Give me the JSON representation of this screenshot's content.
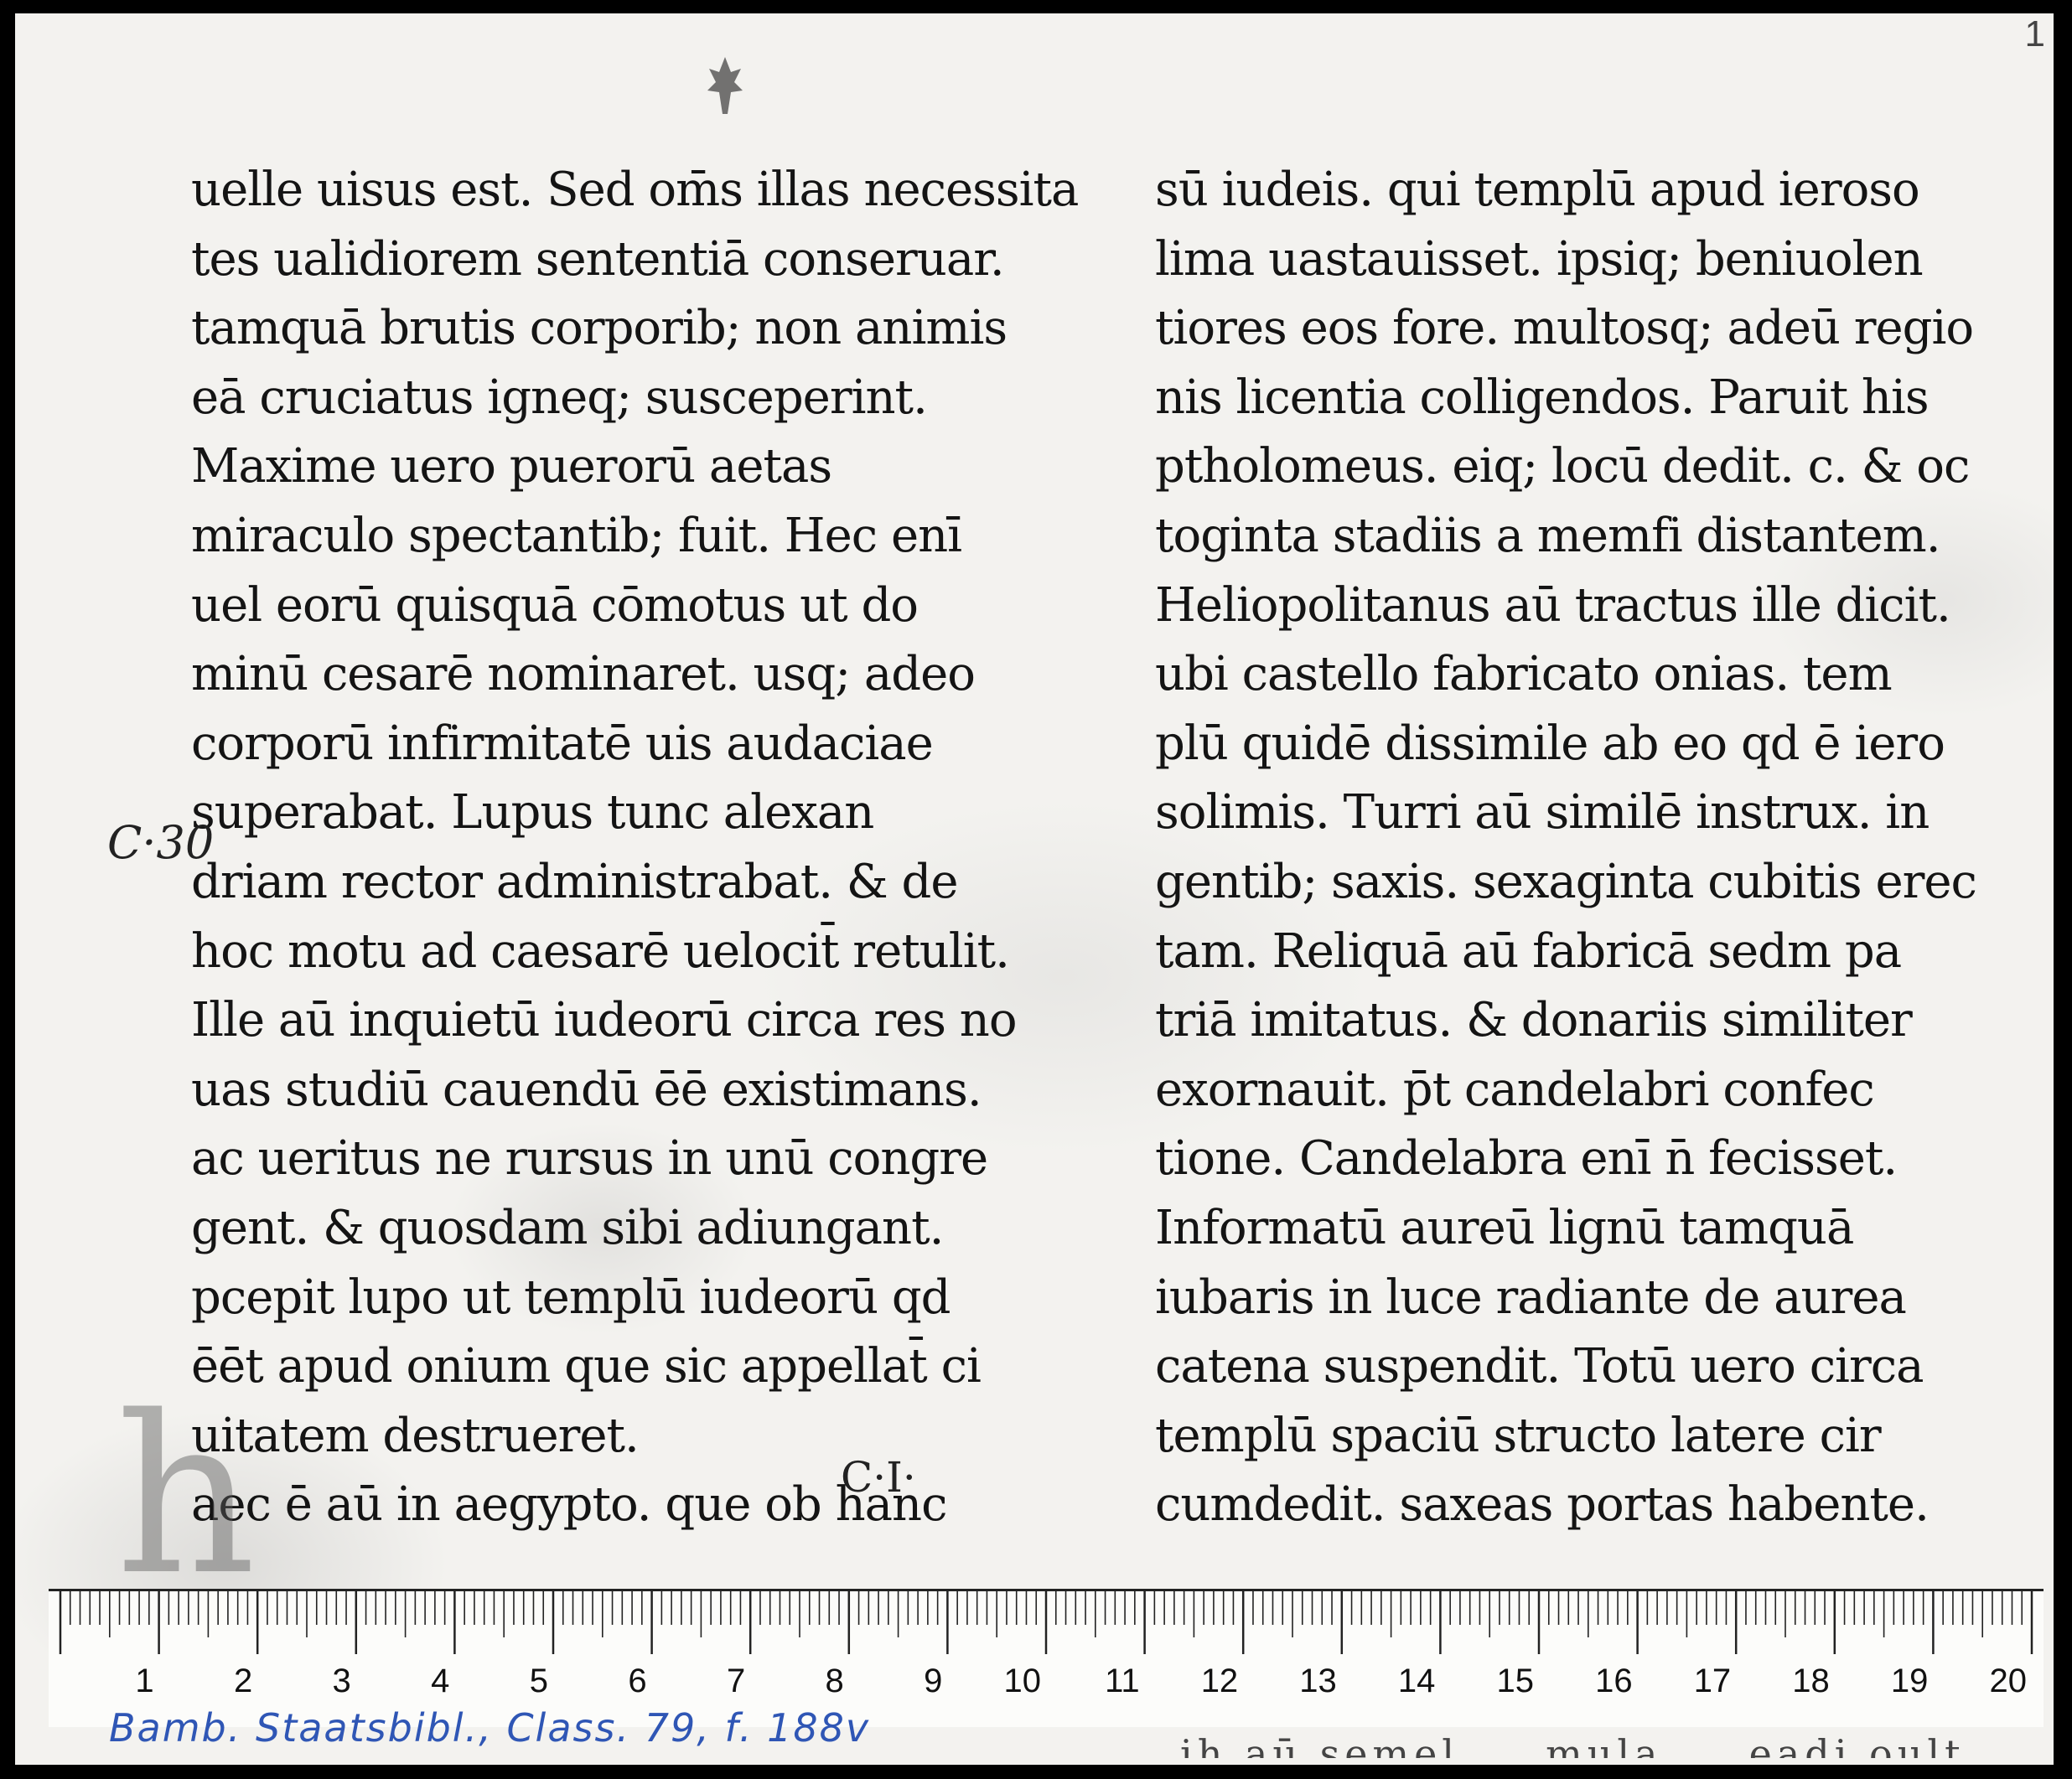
{
  "corner_mark": "1",
  "left_column": [
    "uelle uisus est. Sed om̄s illas necessita",
    "tes ualidiorem sententiā conseruar.",
    "tamquā brutis corporib; non animis",
    "eā cruciatus igneq; susceperint.",
    "Maxime uero puerorū aetas",
    "miraculo spectantib; fuit. Hec enī",
    "uel eorū quisquā cōmotus ut do",
    "minū cesarē nominaret. usq; adeo",
    "corporū infirmitatē uis audaciae",
    "superabat. Lupus tunc alexan",
    "driam rector administrabat. & de",
    "hoc motu ad caesarē uelocit̄ retulit.",
    "Ille aū inquietū iudeorū circa res no",
    "uas studiū cauendū ēē existimans.",
    "ac ueritus ne rursus in unū congre",
    "gent. & quosdam sibi adiungant.",
    "pcepit lupo ut templū iudeorū qd",
    "ēēt apud onium que sic appellat̄ ci",
    "uitatem destrueret.",
    "aec ē aū in aegypto. que ob hanc"
  ],
  "right_column": [
    "sū iudeis. qui templū apud ieroso",
    "lima uastauisset. ipsiq; beniuolen",
    "tiores eos fore. multosq; adeū regio",
    "nis licentia colligendos. Paruit his",
    "ptholomeus. eiq; locū dedit. c. & oc",
    "toginta stadiis a memfi distantem.",
    "Heliopolitanus aū tractus ille dicit.",
    "ubi castello fabricato onias. tem",
    "plū quidē dissimile ab eo qd ē iero",
    "solimis. Turri aū similē instrux. in",
    "gentib; saxis. sexaginta cubitis erec",
    "tam. Reliquā aū fabricā sedm pa",
    "triā imitatus. & donariis similiter",
    "exornauit. p̄t candelabri confec",
    "tione. Candelabra enī n̄ fecisset.",
    "Informatū aureū lignū tamquā",
    "iubaris in luce radiante de aurea",
    "catena suspendit. Totū uero circa",
    "templū spaciū structo latere cir",
    "cumdedit. saxeas portas habente."
  ],
  "margin_left": "C·30",
  "margin_c1": "C·I·",
  "big_initial": "h",
  "ruler_labels": [
    "1",
    "2",
    "3",
    "4",
    "5",
    "6",
    "7",
    "8",
    "9",
    "10",
    "11",
    "12",
    "13",
    "14",
    "15",
    "16",
    "17",
    "18",
    "19",
    "20"
  ],
  "bottom_partial": "ih aū semel ... mula ... eadi oult",
  "caption": "Bamb. Staatsbibl., Class. 79, f. 188v"
}
